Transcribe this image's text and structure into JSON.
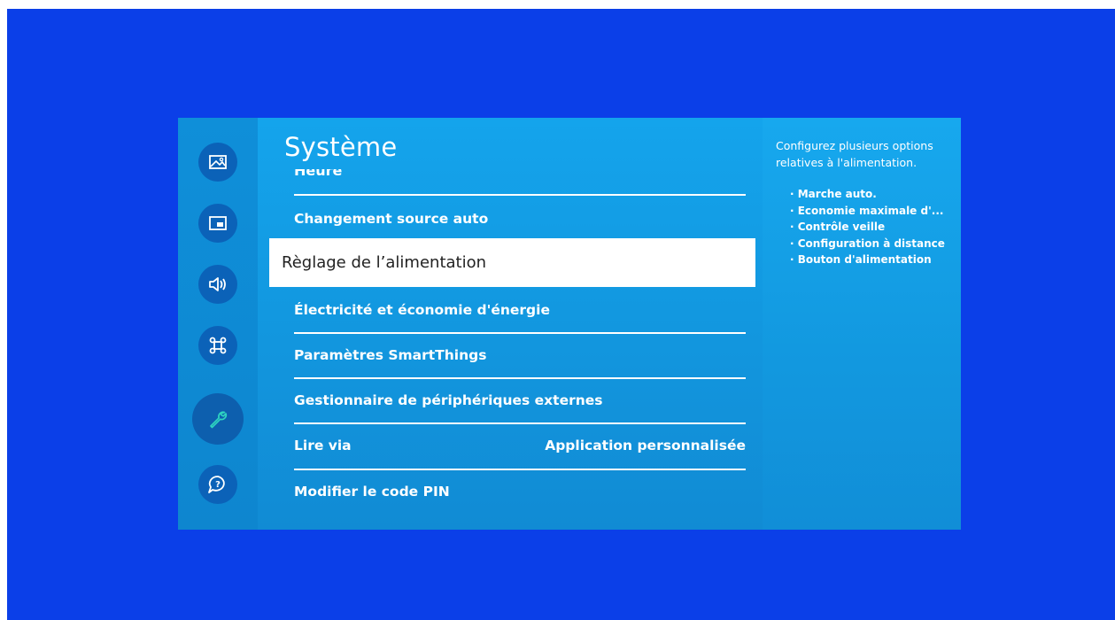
{
  "menu": {
    "title": "Système",
    "partial_item": "Heure",
    "selected_item": "Règlage de l’alimentation",
    "items": [
      {
        "label": "Changement source auto",
        "value": ""
      },
      {
        "label": "Électricité et économie d'énergie",
        "value": ""
      },
      {
        "label": "Paramètres SmartThings",
        "value": ""
      },
      {
        "label": "Gestionnaire de périphériques externes",
        "value": ""
      },
      {
        "label": "Lire via",
        "value": "Application personnalisée"
      },
      {
        "label": "Modifier le code PIN",
        "value": ""
      }
    ]
  },
  "sidebar": {
    "icons": [
      "picture-icon",
      "pip-icon",
      "sound-icon",
      "connection-icon",
      "wrench-icon",
      "support-icon"
    ],
    "active": "wrench-icon"
  },
  "info": {
    "description": "Configurez plusieurs options relatives à l'alimentation.",
    "options": [
      "· Marche auto.",
      "· Economie maximale d'...",
      "· Contrôle veille",
      "· Configuration à distance",
      "· Bouton d'alimentation"
    ]
  },
  "colors": {
    "background": "#0b3fe8",
    "panel": "#1296de",
    "icon_circle": "#0b62b8",
    "active_icon_stroke": "#2ed4c0",
    "selected_bg": "#ffffff"
  }
}
